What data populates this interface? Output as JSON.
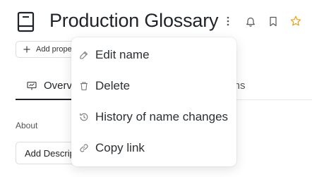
{
  "header": {
    "title": "Production Glossary",
    "icons": [
      "book-icon",
      "more-vertical-icon",
      "bell-icon",
      "bookmark-icon",
      "star-icon"
    ],
    "star_color": "#e5a823"
  },
  "toolbar": {
    "add_property_label": "Add prope"
  },
  "tabs": {
    "overview_label": "Overvi",
    "hidden_tab_suffix": "ions"
  },
  "about": {
    "label": "About",
    "add_description_label": "Add Descrip"
  },
  "menu": {
    "items": [
      {
        "label": "Edit name",
        "icon": "edit-icon"
      },
      {
        "label": "Delete",
        "icon": "trash-icon"
      },
      {
        "label": "History of name changes",
        "icon": "history-icon"
      },
      {
        "label": "Copy link",
        "icon": "link-icon"
      }
    ]
  }
}
